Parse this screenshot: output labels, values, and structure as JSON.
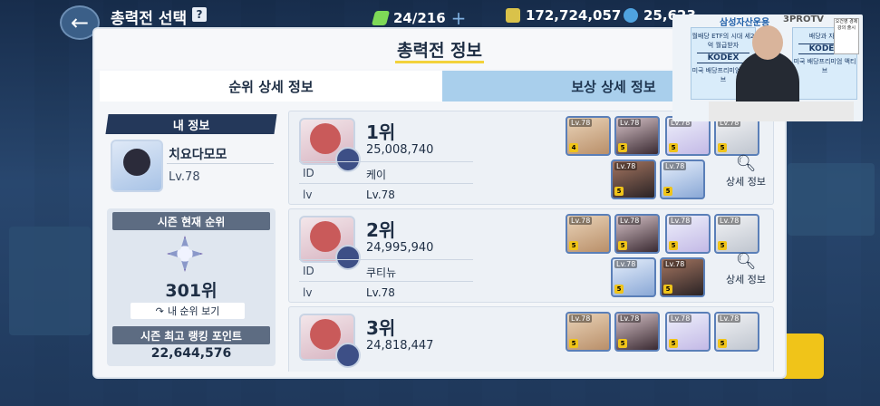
{
  "topbar": {
    "back_icon": "arrow-left-icon",
    "title": "총력전 선택",
    "help_label": "?",
    "stamina": "24/216",
    "stamina_add": "+",
    "credits": "172,724,057",
    "gems": "25,623"
  },
  "modal": {
    "title": "총력전 정보",
    "tabs": [
      {
        "label": "순위 상세 정보",
        "active": true
      },
      {
        "label": "보상 상세 정보",
        "active": false
      }
    ]
  },
  "my_info": {
    "header": "내 정보",
    "name": "치요다모모",
    "level": "Lv.78",
    "season_rank_header": "시즌 현재 순위",
    "season_rank": "301위",
    "my_rank_button": "내 순위 보기",
    "best_points_header": "시즌 최고 랭킹 포인트",
    "best_points": "22,644,576"
  },
  "rankings": {
    "id_label": "ID",
    "lv_label": "lv",
    "detail_label": "상세 정보",
    "entries": [
      {
        "rank": "1위",
        "score": "25,008,740",
        "id": "케이",
        "lv": "Lv.78"
      },
      {
        "rank": "2위",
        "score": "24,995,940",
        "id": "쿠티뉴",
        "lv": "Lv.78"
      },
      {
        "rank": "3위",
        "score": "24,818,447",
        "id": "",
        "lv": ""
      }
    ]
  },
  "overlay": {
    "channel": "삼성자산운용",
    "brand": "3PROTV",
    "board_text": "월배당 ETF의 시대 세2억 월급받자",
    "kodex": "KODEX",
    "board_sub": "미국 배당프리미엄 액티브",
    "board2_text": "배당과 자산",
    "book_text": "오건영 경제 강의 출시"
  },
  "colors": {
    "accent_yellow": "#f2d23b",
    "header_navy": "#24385a",
    "inactive_tab": "#a9cfec"
  }
}
